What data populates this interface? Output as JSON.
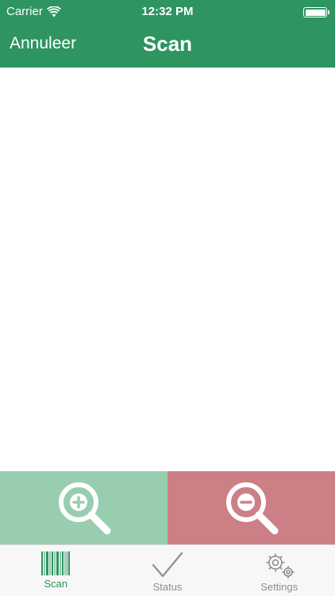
{
  "status_bar": {
    "carrier": "Carrier",
    "time": "12:32 PM",
    "battery_level": 1.0
  },
  "nav": {
    "back_label": "Annuleer",
    "title": "Scan"
  },
  "zoom": {
    "zoom_in_icon": "zoom-in-icon",
    "zoom_out_icon": "zoom-out-icon"
  },
  "tabs": [
    {
      "label": "Scan",
      "icon": "barcode-icon",
      "active": true
    },
    {
      "label": "Status",
      "icon": "checkmark-icon",
      "active": false
    },
    {
      "label": "Settings",
      "icon": "gears-icon",
      "active": false
    }
  ],
  "colors": {
    "brand_green": "#2e9460",
    "zoom_in_bg": "#98cdb0",
    "zoom_out_bg": "#cd7f86",
    "tab_inactive": "#8e8e93"
  }
}
